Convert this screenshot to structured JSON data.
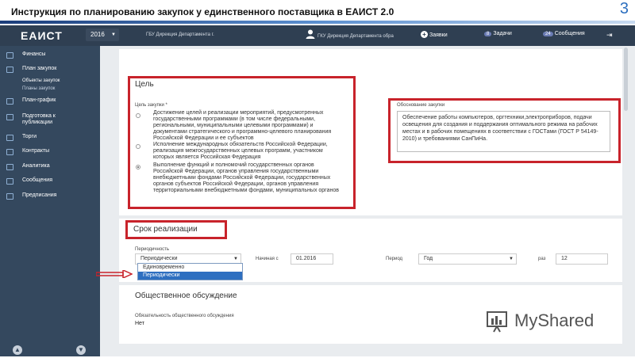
{
  "slide": {
    "title": "Инструкция по планированию  закупок у единственного поставщика в ЕАИСТ 2.0",
    "page_number": "3"
  },
  "topbar": {
    "logo": "ЕАИСТ",
    "year": "2016",
    "org_short": "ГБУ Дирекция Департамента г.",
    "org_user": "ГКУ Дирекция Департамента обра",
    "requests_label": "Заявки",
    "tasks_count": "8",
    "tasks_label": "Задачи",
    "messages_count": "24",
    "messages_label": "Сообщения"
  },
  "sidebar": {
    "items": [
      {
        "label": "Финансы",
        "icon": "finance-icon"
      },
      {
        "label": "План закупок",
        "icon": "plan-icon"
      },
      {
        "label": "План-график",
        "icon": "schedule-icon"
      },
      {
        "label": "Подготовка к",
        "label2": "публикации",
        "icon": "publication-icon"
      },
      {
        "label": "Торги",
        "icon": "tenders-icon"
      },
      {
        "label": "Контракты",
        "icon": "contracts-icon"
      },
      {
        "label": "Аналитика",
        "icon": "analytics-icon"
      },
      {
        "label": "Сообщения",
        "icon": "messages-icon"
      },
      {
        "label": "Предписания",
        "icon": "orders-icon"
      }
    ],
    "subitems": [
      "Объекты закупок",
      "Планы закупок"
    ]
  },
  "goal": {
    "section_title": "Цель",
    "field_label": "Цель закупки *",
    "options": [
      "Достижение целей и реализации мероприятий, предусмотренных государственными программами (в том числе федеральными, региональными, муниципальными целевыми программами) и документами стратегического и программно-целевого планирования Российской Федерации и ее субъектов",
      "Исполнение международных обязательств Российской Федерации, реализация межгосударственных целевых программ, участником которых является Российская Федерация",
      "Выполнение функций и полномочий государственных органов Российской Федерации, органов управления государственными внебюджетными фондами Российской Федерации, государственных органов субъектов Российской Федерации, органов управления территориальными внебюджетными фондами, муниципальных органов"
    ],
    "selected_index": 2,
    "justification_label": "Обоснование закупки",
    "justification_text": "Обеспечение работы компьютеров, оргтехники,электроприборов, подачи освещения для создания и поддержания оптимального режима на рабочих местах и в рабочих помещениях в соответствии с ГОСТами (ГОСТ Р 54149-2010) и требованиями СанПиНа."
  },
  "period": {
    "section_title": "Срок реализации",
    "periodicity_label": "Периодичность",
    "periodicity_value": "Периодически",
    "dropdown_options": [
      "Единовременно",
      "Периодически"
    ],
    "dropdown_selected": "Периодически",
    "start_label": "Начиная с",
    "start_value": "01.2016",
    "period_label": "Период",
    "period_value": "Год",
    "times_label": "раз",
    "times_value": "12"
  },
  "discussion": {
    "section_title": "Общественное обсуждение",
    "field_label": "Обязательность общественного обсуждения",
    "field_value": "Нет"
  },
  "watermark": "MyShared",
  "colors": {
    "highlight_red": "#c8232b",
    "sidebar": "#34485e",
    "topbar": "#2f3f52",
    "dropdown_selected": "#2e6fc0"
  }
}
